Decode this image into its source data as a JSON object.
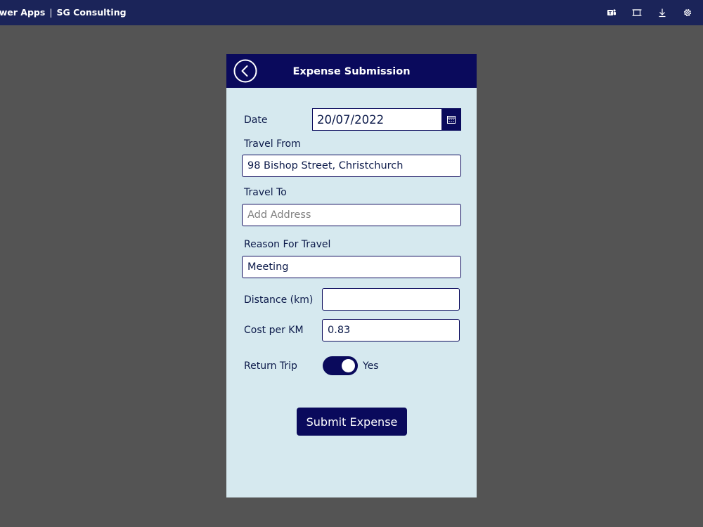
{
  "topbar": {
    "app_name": "Power Apps",
    "separator": "|",
    "org_name": "SG Consulting",
    "icons": [
      "teams-icon",
      "fullscreen-icon",
      "download-icon",
      "settings-icon"
    ]
  },
  "header": {
    "title": "Expense Submission",
    "back_icon": "back-arrow-icon"
  },
  "form": {
    "date_label": "Date",
    "date_value": "20/07/2022",
    "travel_from_label": "Travel From",
    "travel_from_value": "98 Bishop Street, Christchurch",
    "travel_to_label": "Travel To",
    "travel_to_value": "",
    "travel_to_placeholder": "Add Address",
    "reason_label": "Reason For Travel",
    "reason_value": "Meeting",
    "distance_label": "Distance (km)",
    "distance_value": "",
    "cost_label": "Cost per KM",
    "cost_value": "0.83",
    "return_label": "Return Trip",
    "return_state": "Yes",
    "submit_label": "Submit Expense"
  },
  "colors": {
    "topbar": "#1b2459",
    "accent": "#0a0a5c",
    "screen_bg": "#d6e9ef",
    "backdrop": "#545454"
  }
}
